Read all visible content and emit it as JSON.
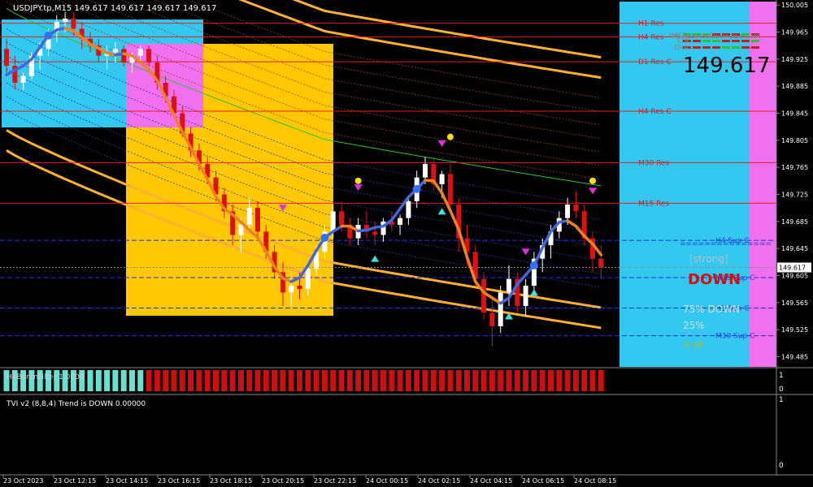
{
  "header": {
    "title": "USDJPY.tp,M15  149.617 149.617 149.617 149.617"
  },
  "colors": {
    "background": "#000000",
    "yellow_zone": "#FFC800",
    "blue_zone": "#33C8F0",
    "pink_zone": "#F070F0",
    "bull": "#FFFFFF",
    "bear": "#E01010",
    "ma_orange": "#F08020",
    "ma_blue": "#4466DD",
    "band": "#FFB030",
    "res_line": "#E02020",
    "sup_line": "#2030E0",
    "osc_teal": "#66E0D0",
    "osc_red": "#CC1010"
  },
  "levels": {
    "res": [
      {
        "label": "H1 Res",
        "price": 149.978
      },
      {
        "label": "H4 Res",
        "price": 149.958
      },
      {
        "label": "D1 Res C",
        "price": 149.921
      },
      {
        "label": "H4 Res C",
        "price": 149.848
      },
      {
        "label": "M30 Res",
        "price": 149.772
      },
      {
        "label": "M15 Res",
        "price": 149.712
      }
    ],
    "sup": [
      {
        "label": "H4 Sup C",
        "price": 149.657
      },
      {
        "label": "M15 Sup C",
        "price": 149.602
      },
      {
        "label": "H1 Sup C",
        "price": 149.557
      },
      {
        "label": "M30 Sup C",
        "price": 149.516
      }
    ]
  },
  "panel": {
    "tf_header": "M5 M15 M30 H1 H4 D1 W1 MN",
    "rows": [
      "MACD",
      "STR",
      "EMA"
    ],
    "price_big": "149.617",
    "separator": "===============",
    "strength": "[strong]",
    "direction": "DOWN",
    "down_pct": "75% DOWN",
    "up_pct": "25%",
    "misc": "+  UP"
  },
  "indicator1": {
    "label": "H4BorenFilter 1.0000",
    "ticks": [
      "1",
      "0"
    ]
  },
  "indicator2": {
    "label": "TVI v2 (8,8,4) Trend is DOWN 0.00000",
    "ticks": [
      "1",
      "0"
    ]
  },
  "chart_data": {
    "type": "candlestick",
    "symbol": "USDJPY.tp",
    "timeframe": "M15",
    "last_price": 149.617,
    "ylim": [
      149.47,
      150.01
    ],
    "y_ticks": [
      150.005,
      149.965,
      149.925,
      149.885,
      149.845,
      149.805,
      149.765,
      149.725,
      149.685,
      149.645,
      149.605,
      149.565,
      149.525,
      149.485
    ],
    "x_ticks": [
      "23 Oct 2023",
      "23 Oct 12:15",
      "23 Oct 14:15",
      "23 Oct 16:15",
      "23 Oct 18:15",
      "23 Oct 20:15",
      "23 Oct 22:15",
      "24 Oct 00:15",
      "24 Oct 02:15",
      "24 Oct 04:15",
      "24 Oct 06:15",
      "24 Oct 08:15"
    ],
    "candles": [
      [
        149.94,
        149.955,
        149.905,
        149.915
      ],
      [
        149.915,
        149.93,
        149.88,
        149.89
      ],
      [
        149.89,
        149.905,
        149.88,
        149.9
      ],
      [
        149.9,
        149.935,
        149.895,
        149.93
      ],
      [
        149.93,
        149.95,
        149.91,
        149.94
      ],
      [
        149.94,
        149.97,
        149.93,
        149.965
      ],
      [
        149.965,
        149.99,
        149.95,
        149.98
      ],
      [
        149.98,
        149.995,
        149.965,
        149.985
      ],
      [
        149.985,
        149.995,
        149.96,
        149.97
      ],
      [
        149.97,
        149.98,
        149.94,
        149.955
      ],
      [
        149.955,
        149.965,
        149.935,
        149.945
      ],
      [
        149.945,
        149.955,
        149.92,
        149.93
      ],
      [
        149.93,
        149.945,
        149.91,
        149.935
      ],
      [
        149.935,
        149.95,
        149.92,
        149.94
      ],
      [
        149.94,
        149.945,
        149.915,
        149.92
      ],
      [
        149.92,
        149.935,
        149.905,
        149.93
      ],
      [
        149.93,
        149.945,
        149.92,
        149.94
      ],
      [
        149.94,
        149.945,
        149.915,
        149.92
      ],
      [
        149.92,
        149.93,
        149.88,
        149.89
      ],
      [
        149.89,
        149.9,
        149.86,
        149.87
      ],
      [
        149.87,
        149.88,
        149.84,
        149.845
      ],
      [
        149.845,
        149.855,
        149.81,
        149.815
      ],
      [
        149.815,
        149.825,
        149.78,
        149.79
      ],
      [
        149.79,
        149.8,
        149.76,
        149.77
      ],
      [
        149.77,
        149.78,
        149.74,
        149.75
      ],
      [
        149.75,
        149.76,
        149.715,
        149.725
      ],
      [
        149.725,
        149.735,
        149.69,
        149.7
      ],
      [
        149.7,
        149.71,
        149.65,
        149.665
      ],
      [
        149.665,
        149.69,
        149.64,
        149.68
      ],
      [
        149.68,
        149.72,
        149.67,
        149.705
      ],
      [
        149.705,
        149.715,
        149.66,
        149.67
      ],
      [
        149.67,
        149.68,
        149.63,
        149.64
      ],
      [
        149.64,
        149.65,
        149.6,
        149.61
      ],
      [
        149.61,
        149.625,
        149.56,
        149.58
      ],
      [
        149.58,
        149.6,
        149.56,
        149.59
      ],
      [
        149.59,
        149.61,
        149.57,
        149.585
      ],
      [
        149.585,
        149.62,
        149.575,
        149.615
      ],
      [
        149.615,
        149.65,
        149.605,
        149.64
      ],
      [
        149.64,
        149.68,
        149.63,
        149.67
      ],
      [
        149.67,
        149.71,
        149.66,
        149.7
      ],
      [
        149.7,
        149.715,
        149.67,
        149.68
      ],
      [
        149.68,
        149.69,
        149.65,
        149.66
      ],
      [
        149.66,
        149.69,
        149.65,
        149.68
      ],
      [
        149.68,
        149.7,
        149.66,
        149.67
      ],
      [
        149.67,
        149.685,
        149.65,
        149.665
      ],
      [
        149.665,
        149.69,
        149.655,
        149.685
      ],
      [
        149.685,
        149.7,
        149.67,
        149.68
      ],
      [
        149.68,
        149.695,
        149.665,
        149.69
      ],
      [
        149.69,
        149.72,
        149.68,
        149.715
      ],
      [
        149.715,
        149.76,
        149.705,
        149.75
      ],
      [
        149.75,
        149.78,
        149.74,
        149.77
      ],
      [
        149.77,
        149.78,
        149.73,
        149.74
      ],
      [
        149.74,
        149.76,
        149.72,
        149.755
      ],
      [
        149.755,
        149.77,
        149.7,
        149.71
      ],
      [
        149.71,
        149.72,
        149.64,
        149.66
      ],
      [
        149.66,
        149.68,
        149.62,
        149.64
      ],
      [
        149.64,
        149.65,
        149.59,
        149.6
      ],
      [
        149.6,
        149.61,
        149.54,
        149.55
      ],
      [
        149.55,
        149.57,
        149.5,
        149.53
      ],
      [
        149.53,
        149.59,
        149.52,
        149.58
      ],
      [
        149.58,
        149.62,
        149.56,
        149.6
      ],
      [
        149.6,
        149.61,
        149.55,
        149.56
      ],
      [
        149.56,
        149.6,
        149.545,
        149.59
      ],
      [
        149.59,
        149.64,
        149.58,
        149.63
      ],
      [
        149.63,
        149.66,
        149.61,
        149.65
      ],
      [
        149.65,
        149.68,
        149.63,
        149.67
      ],
      [
        149.67,
        149.7,
        149.66,
        149.69
      ],
      [
        149.69,
        149.72,
        149.68,
        149.71
      ],
      [
        149.71,
        149.73,
        149.69,
        149.7
      ],
      [
        149.7,
        149.71,
        149.65,
        149.66
      ],
      [
        149.66,
        149.67,
        149.61,
        149.63
      ],
      [
        149.63,
        149.65,
        149.6,
        149.617
      ]
    ]
  }
}
